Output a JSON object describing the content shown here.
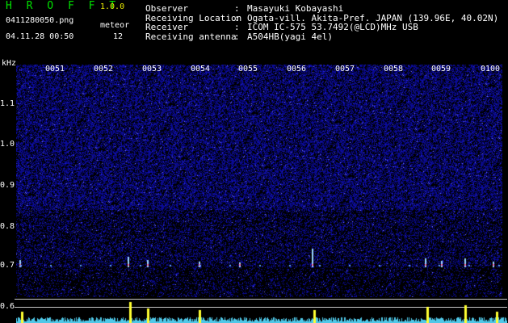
{
  "header": {
    "app_title": "H R O F F T",
    "version": "1.0.0",
    "filename": "0411280050.png",
    "datetime": "04.11.28 00:50",
    "meteor_label": "meteor",
    "meteor_count": "12"
  },
  "info": [
    {
      "key": "Observer",
      "value": "Masayuki Kobayashi"
    },
    {
      "key": "Receiving Location",
      "value": "Ogata-vill. Akita-Pref. JAPAN (139.96E, 40.02N)"
    },
    {
      "key": "Receiver",
      "value": "ICOM IC-575 53.7492(@LCD)MHz USB"
    },
    {
      "key": "Receiving antenna",
      "value": "A504HB(yagi 4el)"
    }
  ],
  "info_separator": ":",
  "axis": {
    "y_unit": "kHz",
    "y_ticks": [
      "1.1",
      "1.0",
      "0.9",
      "0.8",
      "0.7",
      "0.6"
    ],
    "x_ticks": [
      "0051",
      "0052",
      "0053",
      "0054",
      "0055",
      "0056",
      "0057",
      "0058",
      "0059",
      "0100"
    ]
  },
  "colors": {
    "background": "#000000",
    "title": "#00e000",
    "version": "#e8e800",
    "noise": "#1a1aa8",
    "echo": "#9ad6ff",
    "meter": "#4fc8e8",
    "meter_peak": "#ffff30"
  }
}
